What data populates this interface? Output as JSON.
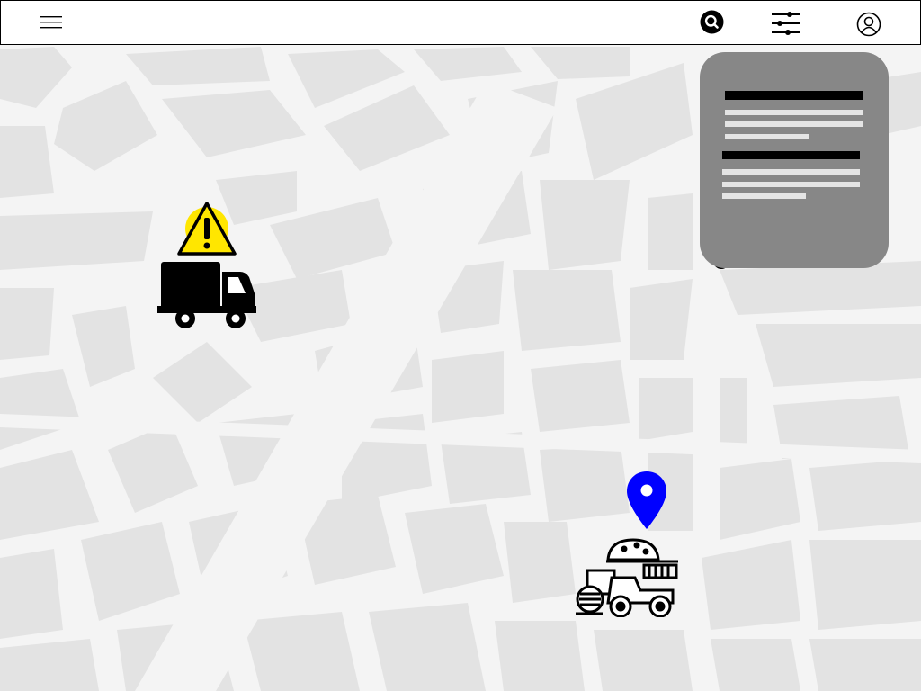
{
  "toolbar": {
    "menu_icon": "hamburger-menu-icon",
    "search_icon": "search-icon",
    "filter_icon": "sliders-filter-icon",
    "account_icon": "user-account-icon"
  },
  "map": {
    "background_color": "#f4f4f4",
    "block_color": "#e3e3e3",
    "markers": [
      {
        "icon": "warning-icon",
        "color": "#ffe600"
      },
      {
        "icon": "delivery-truck-icon",
        "color": "#000000"
      },
      {
        "icon": "location-pin-icon",
        "color": "#0000ff"
      },
      {
        "icon": "farm-tractor-icon",
        "color": "#000000"
      }
    ]
  },
  "info_panel": {
    "color": "#878787",
    "sections": 2
  }
}
